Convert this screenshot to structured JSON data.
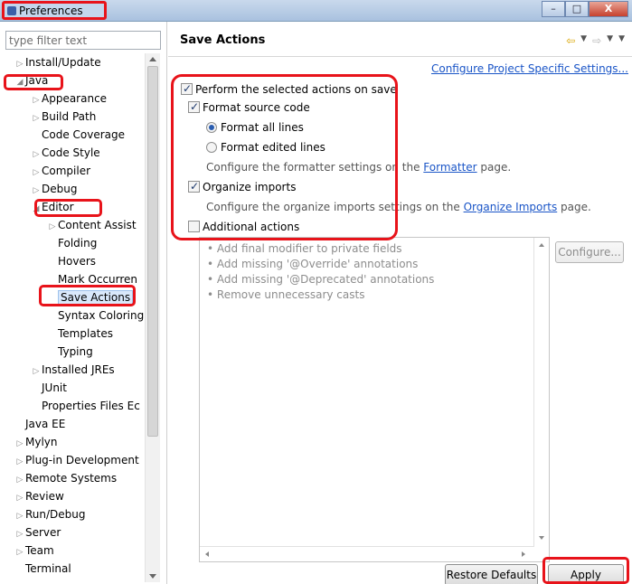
{
  "window": {
    "title": "Preferences",
    "controls": {
      "minimize": "–",
      "maximize": "□",
      "close": "X"
    }
  },
  "sidebar": {
    "filter_placeholder": "type filter text",
    "items": [
      {
        "label": "Install/Update",
        "level": 1,
        "twisty": "collapsed"
      },
      {
        "label": "Java",
        "level": 1,
        "twisty": "expanded"
      },
      {
        "label": "Appearance",
        "level": 2,
        "twisty": "collapsed"
      },
      {
        "label": "Build Path",
        "level": 2,
        "twisty": "collapsed"
      },
      {
        "label": "Code Coverage",
        "level": 2,
        "twisty": "none"
      },
      {
        "label": "Code Style",
        "level": 2,
        "twisty": "collapsed"
      },
      {
        "label": "Compiler",
        "level": 2,
        "twisty": "collapsed"
      },
      {
        "label": "Debug",
        "level": 2,
        "twisty": "collapsed"
      },
      {
        "label": "Editor",
        "level": 2,
        "twisty": "expanded"
      },
      {
        "label": "Content Assist",
        "level": 3,
        "twisty": "collapsed"
      },
      {
        "label": "Folding",
        "level": 3,
        "twisty": "none"
      },
      {
        "label": "Hovers",
        "level": 3,
        "twisty": "none"
      },
      {
        "label": "Mark Occurren",
        "level": 3,
        "twisty": "none"
      },
      {
        "label": "Save Actions",
        "level": 3,
        "twisty": "none",
        "selected": true
      },
      {
        "label": "Syntax Coloring",
        "level": 3,
        "twisty": "none"
      },
      {
        "label": "Templates",
        "level": 3,
        "twisty": "none"
      },
      {
        "label": "Typing",
        "level": 3,
        "twisty": "none"
      },
      {
        "label": "Installed JREs",
        "level": 2,
        "twisty": "collapsed"
      },
      {
        "label": "JUnit",
        "level": 2,
        "twisty": "none"
      },
      {
        "label": "Properties Files Ec",
        "level": 2,
        "twisty": "none"
      },
      {
        "label": "Java EE",
        "level": 1,
        "twisty": "none"
      },
      {
        "label": "Mylyn",
        "level": 1,
        "twisty": "collapsed"
      },
      {
        "label": "Plug-in Development",
        "level": 1,
        "twisty": "collapsed"
      },
      {
        "label": "Remote Systems",
        "level": 1,
        "twisty": "collapsed"
      },
      {
        "label": "Review",
        "level": 1,
        "twisty": "collapsed"
      },
      {
        "label": "Run/Debug",
        "level": 1,
        "twisty": "collapsed"
      },
      {
        "label": "Server",
        "level": 1,
        "twisty": "collapsed"
      },
      {
        "label": "Team",
        "level": 1,
        "twisty": "collapsed"
      },
      {
        "label": "Terminal",
        "level": 1,
        "twisty": "none"
      }
    ]
  },
  "main": {
    "title": "Save Actions",
    "nav": {
      "back": "⇦",
      "forward": "⇨",
      "dropdown": "▼"
    },
    "project_settings_link": "Configure Project Specific Settings...",
    "perform_on_save": {
      "label": "Perform the selected actions on save",
      "checked": true
    },
    "format_source": {
      "label": "Format source code",
      "checked": true
    },
    "format_all": {
      "label": "Format all lines",
      "selected": true
    },
    "format_edited": {
      "label": "Format edited lines",
      "selected": false
    },
    "formatter_desc": {
      "pre": "Configure the formatter settings on the ",
      "link": "Formatter",
      "post": " page."
    },
    "organize_imports": {
      "label": "Organize imports",
      "checked": true
    },
    "organize_desc": {
      "pre": "Configure the organize imports settings on the ",
      "link": "Organize Imports",
      "post": " page."
    },
    "additional_actions": {
      "label": "Additional actions",
      "checked": false
    },
    "action_items": [
      "Add final modifier to private fields",
      "Add missing '@Override' annotations",
      "Add missing '@Deprecated' annotations",
      "Remove unnecessary casts"
    ],
    "configure_button": "Configure...",
    "restore_defaults_button": "Restore Defaults",
    "apply_button": "Apply"
  },
  "colors": {
    "annotation": "#e8131a",
    "link": "#1a55c7",
    "selection": "#d9e8fb"
  }
}
